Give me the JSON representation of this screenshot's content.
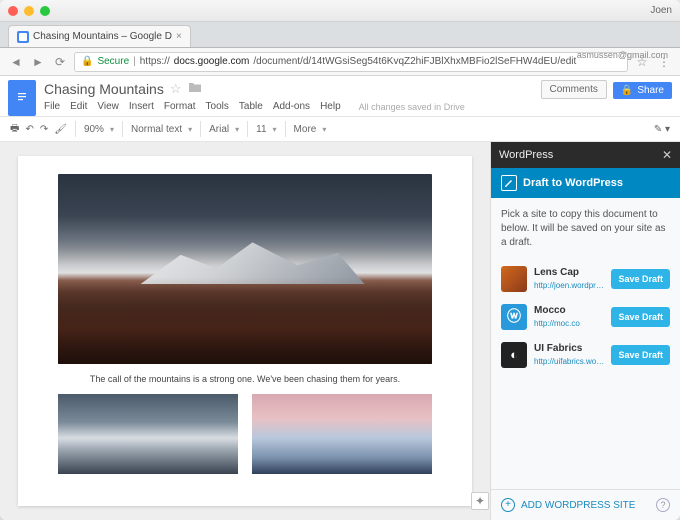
{
  "browser": {
    "user_label": "Joen",
    "tab_title": "Chasing Mountains – Google D",
    "url_secure_label": "Secure",
    "url_host": "https://",
    "url_domain": "docs.google.com",
    "url_path": "/document/d/14tWGsiSeg54t6KvqZ2hiFJBlXhxMBFio2lSeFHW4dEU/edit"
  },
  "docs": {
    "account_email": "asmussen@gmail.com",
    "title": "Chasing Mountains",
    "menus": [
      "File",
      "Edit",
      "View",
      "Insert",
      "Format",
      "Tools",
      "Table",
      "Add-ons",
      "Help"
    ],
    "saved_status": "All changes saved in Drive",
    "comments_label": "Comments",
    "share_label": "Share",
    "toolbar": {
      "zoom": "90%",
      "style": "Normal text",
      "font": "Arial",
      "size": "11",
      "more": "More"
    }
  },
  "document": {
    "caption": "The call of the mountains is a strong one. We've been chasing them for years."
  },
  "sidebar": {
    "title": "WordPress",
    "banner": "Draft to WordPress",
    "intro": "Pick a site to copy this document to below. It will be saved on your site as a draft.",
    "save_label": "Save Draft",
    "sites": [
      {
        "name": "Lens Cap",
        "url": "http://joen.wordpress...."
      },
      {
        "name": "Mocco",
        "url": "http://moc.co"
      },
      {
        "name": "UI Fabrics",
        "url": "http://uifabrics.wordpr..."
      }
    ],
    "add_label": "ADD WORDPRESS SITE"
  }
}
